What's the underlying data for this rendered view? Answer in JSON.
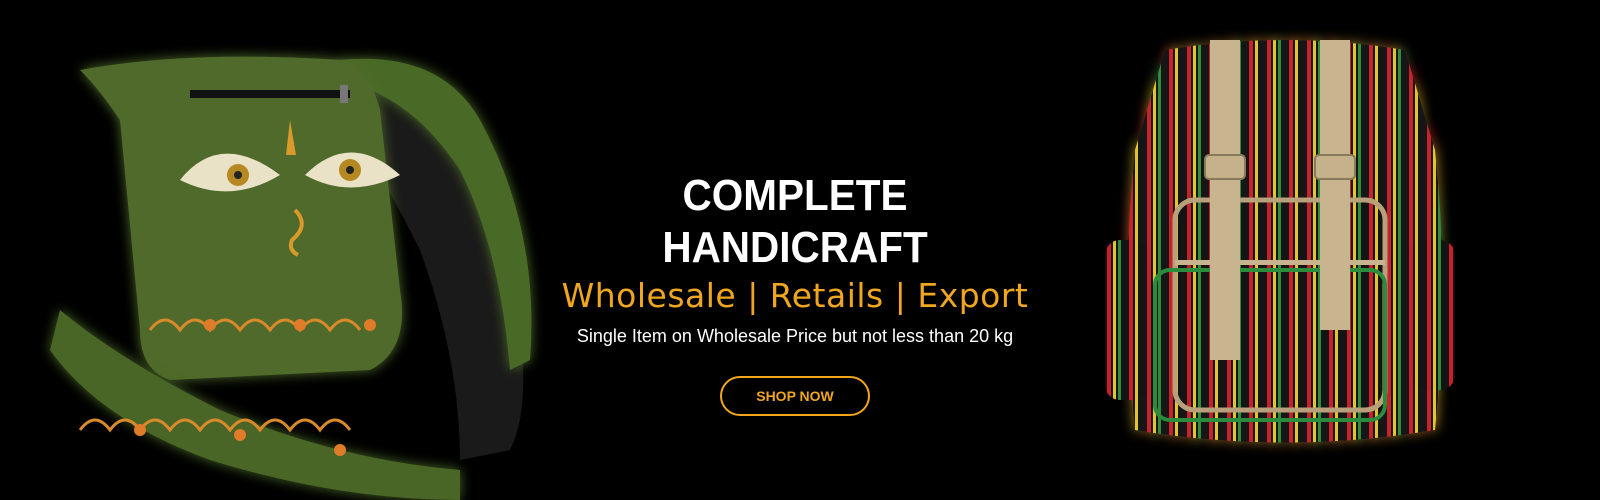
{
  "hero": {
    "headline": "COMPLETE HANDICRAFT",
    "subheadline": "Wholesale | Retails | Export",
    "tagline": "Single Item on Wholesale Price but not less than 20 kg",
    "cta_label": "SHOP NOW"
  },
  "colors": {
    "background": "#000000",
    "accent": "#f0a71e",
    "text": "#ffffff",
    "bag_green": "#4f6b2c"
  }
}
